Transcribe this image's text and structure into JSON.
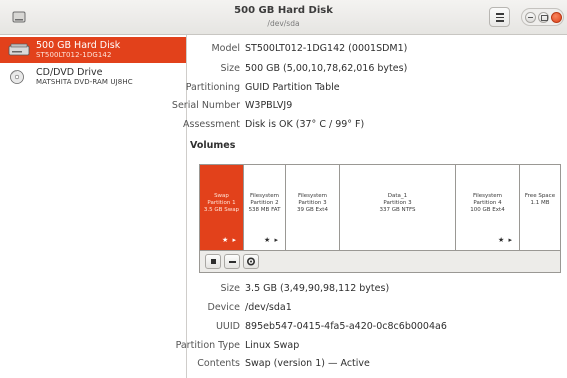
{
  "header": {
    "title": "500 GB Hard Disk",
    "subtitle": "/dev/sda"
  },
  "sidebar": {
    "drives": [
      {
        "name": "500 GB Hard Disk",
        "detail": "ST500LT012-1DG142",
        "selected": true,
        "icon": "hard-disk-icon"
      },
      {
        "name": "CD/DVD Drive",
        "detail": "MATSHITA DVD-RAM UJ8HC",
        "selected": false,
        "icon": "optical-drive-icon"
      }
    ]
  },
  "disk": {
    "model_label": "Model",
    "model": "ST500LT012-1DG142 (0001SDM1)",
    "size_label": "Size",
    "size": "500 GB (5,00,10,78,62,016 bytes)",
    "partitioning_label": "Partitioning",
    "partitioning": "GUID Partition Table",
    "serial_label": "Serial Number",
    "serial": "W3PBLVJ9",
    "assessment_label": "Assessment",
    "assessment": "Disk is OK (37° C / 99° F)"
  },
  "volumes": {
    "heading": "Volumes",
    "partitions": [
      {
        "line1": "Swap",
        "line2": "Partition 1",
        "line3": "3.5 GB Swap",
        "flags": "★ ▸",
        "selected": true
      },
      {
        "line1": "Filesystem",
        "line2": "Partition 2",
        "line3": "538 MB FAT",
        "flags": "★ ▸",
        "selected": false
      },
      {
        "line1": "Filesystem",
        "line2": "Partition 3",
        "line3": "39 GB Ext4",
        "flags": "",
        "selected": false
      },
      {
        "line1": "Data_1",
        "line2": "Partition 3",
        "line3": "337 GB NTFS",
        "flags": "",
        "selected": false
      },
      {
        "line1": "Filesystem",
        "line2": "Partition 4",
        "line3": "100 GB Ext4",
        "flags": "★ ▸",
        "selected": false
      },
      {
        "line1": "Free Space",
        "line2": "1.1 MB",
        "line3": "",
        "flags": "",
        "selected": false
      }
    ],
    "toolbar": [
      "stop-icon",
      "minus-icon",
      "gears-icon"
    ]
  },
  "volume_details": {
    "size_label": "Size",
    "size": "3.5 GB (3,49,90,98,112 bytes)",
    "device_label": "Device",
    "device": "/dev/sda1",
    "uuid_label": "UUID",
    "uuid": "895eb547-0415-4fa5-a420-0c8c6b0004a6",
    "ptype_label": "Partition Type",
    "ptype": "Linux Swap",
    "contents_label": "Contents",
    "contents": "Swap (version 1) — Active"
  },
  "colors": {
    "accent": "#e2411b",
    "close": "#e0431c"
  }
}
